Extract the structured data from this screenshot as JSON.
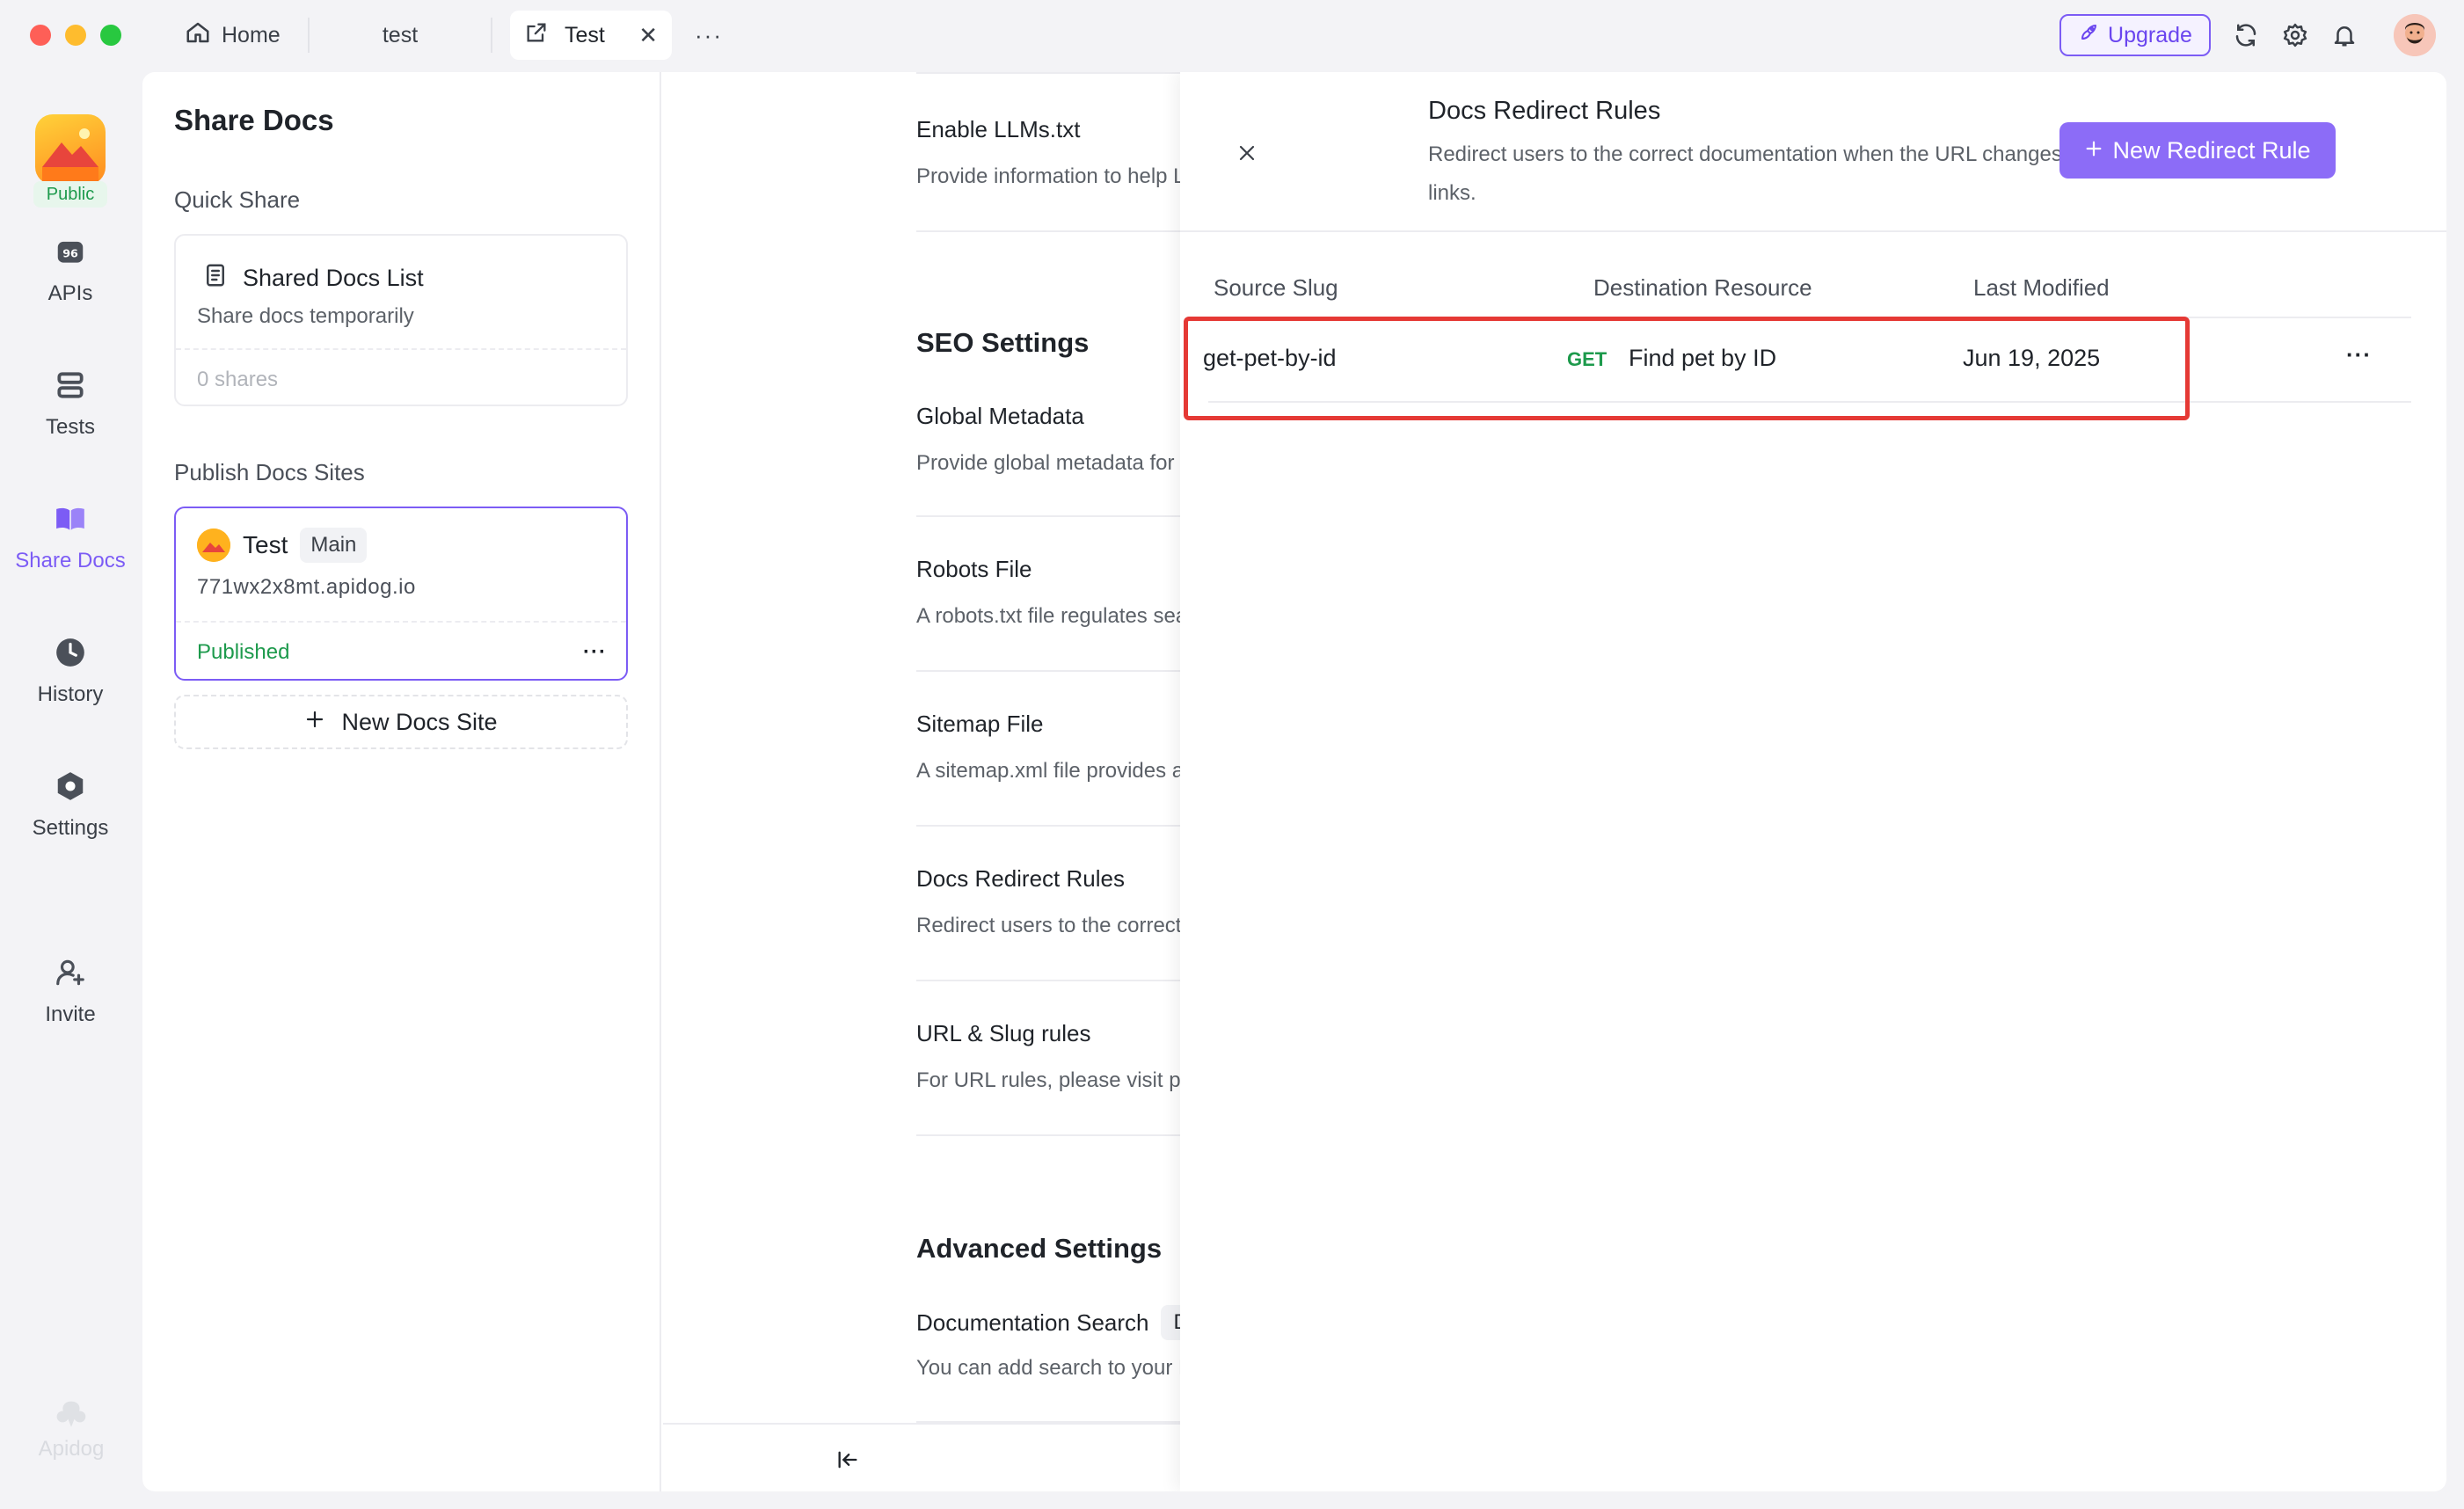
{
  "tabs": {
    "home": "Home",
    "test_plain": "test",
    "active": "Test",
    "more": "···"
  },
  "header": {
    "upgrade_label": "Upgrade",
    "icons": [
      "sync-icon",
      "gear-icon",
      "bell-icon"
    ]
  },
  "project": {
    "visibility": "Public"
  },
  "rail": {
    "items": [
      {
        "label": "APIs",
        "icon": "api-icon"
      },
      {
        "label": "Tests",
        "icon": "tests-icon"
      },
      {
        "label": "Share Docs",
        "icon": "book-icon"
      },
      {
        "label": "History",
        "icon": "clock-icon"
      },
      {
        "label": "Settings",
        "icon": "settings-icon"
      },
      {
        "label": "Invite",
        "icon": "invite-user-icon"
      }
    ],
    "brand": "Apidog"
  },
  "share": {
    "title": "Share Docs",
    "quick_share_label": "Quick Share",
    "shared_list": {
      "title": "Shared Docs List",
      "subtitle": "Share docs temporarily",
      "count": "0 shares"
    },
    "publish_label": "Publish Docs Sites",
    "site": {
      "name": "Test",
      "branch": "Main",
      "url": "771wx2x8mt.apidog.io",
      "status": "Published"
    },
    "new_site_label": "New Docs Site"
  },
  "settings": {
    "llms": {
      "title": "Enable LLMs.txt",
      "desc": "Provide information to help LLMs use the"
    },
    "seo_heading": "SEO Settings",
    "global_meta": {
      "title": "Global Metadata",
      "desc": "Provide global metadata for the entire site"
    },
    "robots": {
      "title": "Robots File",
      "desc": "A robots.txt file regulates search engines"
    },
    "sitemap": {
      "title": "Sitemap File",
      "desc": "A sitemap.xml file provides a list of all the"
    },
    "redirect": {
      "title": "Docs Redirect Rules",
      "desc": "Redirect users to the correct documentat"
    },
    "url_slug": {
      "title": "URL & Slug rules",
      "desc": "For URL rules, please visit project setting"
    },
    "advanced_heading": "Advanced Settings",
    "doc_search": {
      "title": "Documentation Search",
      "tag": "Default",
      "desc": "You can add search to your Docs Site usi"
    }
  },
  "drawer": {
    "title": "Docs Redirect Rules",
    "description": "Redirect users to the correct documentation when the URL changes to prevent broken links.",
    "new_rule_label": "New Redirect Rule",
    "columns": [
      "Source Slug",
      "Destination Resource",
      "Last Modified"
    ],
    "rows": [
      {
        "source": "get-pet-by-id",
        "method": "GET",
        "destination": "Find pet by ID",
        "modified": "Jun 19, 2025",
        "more": "···"
      }
    ]
  },
  "colors": {
    "accent": "#7c5cf5",
    "success": "#1d9a4c",
    "highlight": "#e53935"
  }
}
